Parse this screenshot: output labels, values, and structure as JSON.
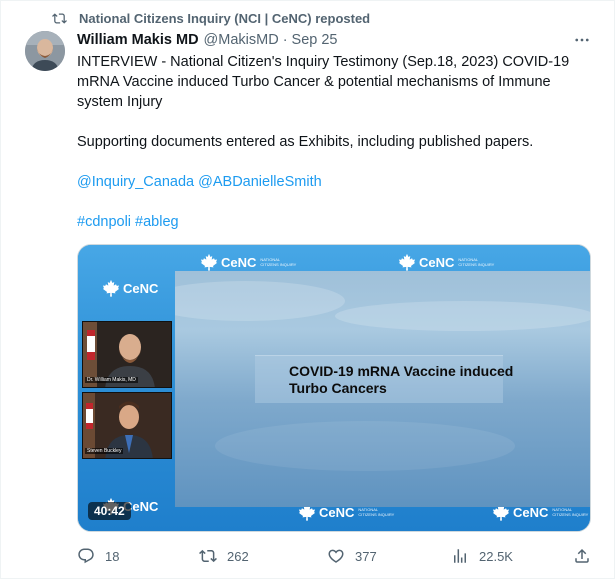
{
  "repost": {
    "text": "National Citizens Inquiry (NCI | CeNC) reposted"
  },
  "author": {
    "name": "William Makis MD",
    "handle": "@MakisMD",
    "separator": "·",
    "time": "Sep 25"
  },
  "menu": {
    "more_label": "···"
  },
  "body": {
    "paragraph1": "INTERVIEW - National Citizen's Inquiry Testimony (Sep.18, 2023) COVID-19 mRNA Vaccine induced Turbo Cancer & potential mechanisms of Immune system Injury",
    "paragraph2": "Supporting documents entered as Exhibits, including published papers.",
    "mention1": "@Inquiry_Canada",
    "mention2": "@ABDanielleSmith",
    "hashtag1": "#cdnpoli",
    "hashtag2": "#ableg"
  },
  "media": {
    "logo_text": "CeNC",
    "logo_subtext": "NATIONAL CITIZENS INQUIRY",
    "slide_title": "COVID-19 mRNA Vaccine induced Turbo Cancers",
    "speaker1": "Dr. William Makis, MD",
    "speaker2": "Steven Buckley",
    "timestamp": "40:42"
  },
  "actions": {
    "replies": "18",
    "reposts": "262",
    "likes": "377",
    "views": "22.5K"
  },
  "colors": {
    "accent": "#1d9bf0",
    "muted": "#536471",
    "text": "#0f1419"
  },
  "icons": [
    "repost-icon",
    "more-icon",
    "reply-icon",
    "like-icon",
    "views-icon",
    "share-icon",
    "maple-leaf-icon"
  ]
}
